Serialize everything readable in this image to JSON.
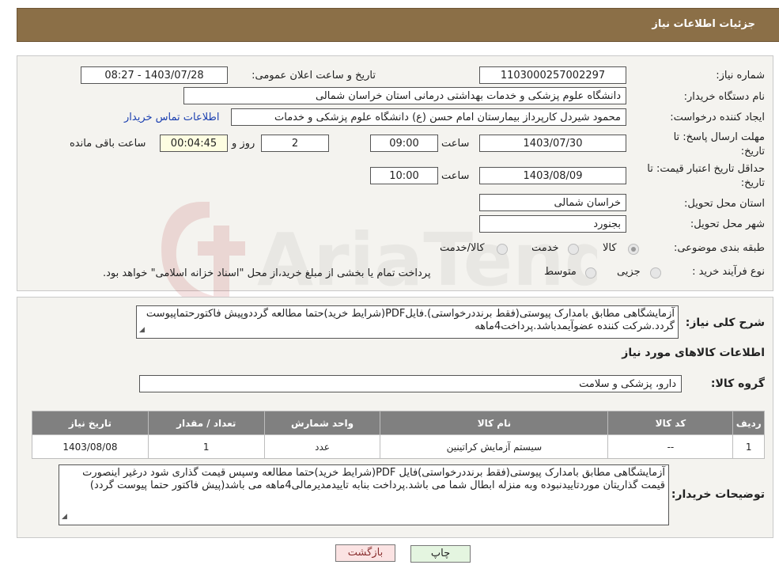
{
  "header": {
    "title": "جزئیات اطلاعات نیاز"
  },
  "form": {
    "need_number_label": "شماره نیاز:",
    "need_number": "1103000257002297",
    "announce_label": "تاریخ و ساعت اعلان عمومی:",
    "announce_value": "1403/07/28 - 08:27",
    "buyer_org_label": "نام دستگاه خریدار:",
    "buyer_org": "دانشگاه علوم پزشکی و خدمات بهداشتی درمانی استان خراسان شمالی",
    "creator_label": "ایجاد کننده درخواست:",
    "creator": "محمود شیردل کارپرداز بیمارستان امام حسن (ع) دانشگاه علوم پزشکی و خدمات",
    "contact_link": "اطلاعات تماس خریدار",
    "deadline_label_1": "مهلت ارسال پاسخ: تا",
    "deadline_label_2": "تاریخ:",
    "deadline_date": "1403/07/30",
    "time_label": "ساعت",
    "deadline_time": "09:00",
    "days_value": "2",
    "days_label": "روز و",
    "remaining_value": "00:04:45",
    "remaining_label": "ساعت باقی مانده",
    "validity_label_1": "حداقل تاریخ اعتبار قیمت: تا",
    "validity_label_2": "تاریخ:",
    "validity_date": "1403/08/09",
    "validity_time_label": "ساعت",
    "validity_time": "10:00",
    "province_label": "استان محل تحویل:",
    "province": "خراسان شمالی",
    "city_label": "شهر محل تحویل:",
    "city": "بجنورد",
    "category_label": "طبقه بندی موضوعی:",
    "category_options": [
      "کالا",
      "خدمت",
      "کالا/خدمت"
    ],
    "purchase_type_label": "نوع فرآیند خرید :",
    "purchase_options": [
      "جزیی",
      "متوسط"
    ],
    "purchase_note": "پرداخت تمام یا بخشی از مبلغ خرید،از محل \"اسناد خزانه اسلامی\" خواهد بود."
  },
  "summary": {
    "label": "شرح کلی نیاز:",
    "text": "آزمایشگاهی مطابق بامدارک پیوستی(فقط برنددرخواستی).فایلPDF(شرایط خرید)حتما مطالعه گرددوپیش فاکتورحتماپیوست گردد.شرکت کننده عضوآیمدباشد.پرداخت4ماهه"
  },
  "items_section": {
    "title": "اطلاعات کالاهای مورد نیاز",
    "group_label": "گروه کالا:",
    "group_value": "دارو، پزشکی و سلامت",
    "columns": [
      "ردیف",
      "کد کالا",
      "نام کالا",
      "واحد شمارش",
      "تعداد / مقدار",
      "تاریخ نیاز"
    ],
    "rows": [
      [
        "1",
        "--",
        "سیستم آزمایش کراتینین",
        "عدد",
        "1",
        "1403/08/08"
      ]
    ]
  },
  "buyer_notes": {
    "label": "توضیحات خریدار:",
    "text": "آزمایشگاهی مطابق بامدارک پیوستی(فقط برنددرخواستی)فایل PDF(شرایط خرید)حتما مطالعه وسپس قیمت گذاری شود درغیر اینصورت قیمت گذاریتان موردتاییدنبوده وبه منزله ابطال شما می باشد.پرداخت بنابه تاییدمدیرمالی4ماهه می باشد(پیش فاکتور حتما پیوست گردد)"
  },
  "buttons": {
    "print": "چاپ",
    "back": "بازگشت"
  },
  "watermark": {
    "text": "AriaTender.neT"
  },
  "colors": {
    "header_bg": "#8b6f47",
    "table_header": "#808080",
    "link": "#1a3fb0",
    "back_button": "#fbe3e3",
    "print_button": "#e4f5e0"
  }
}
